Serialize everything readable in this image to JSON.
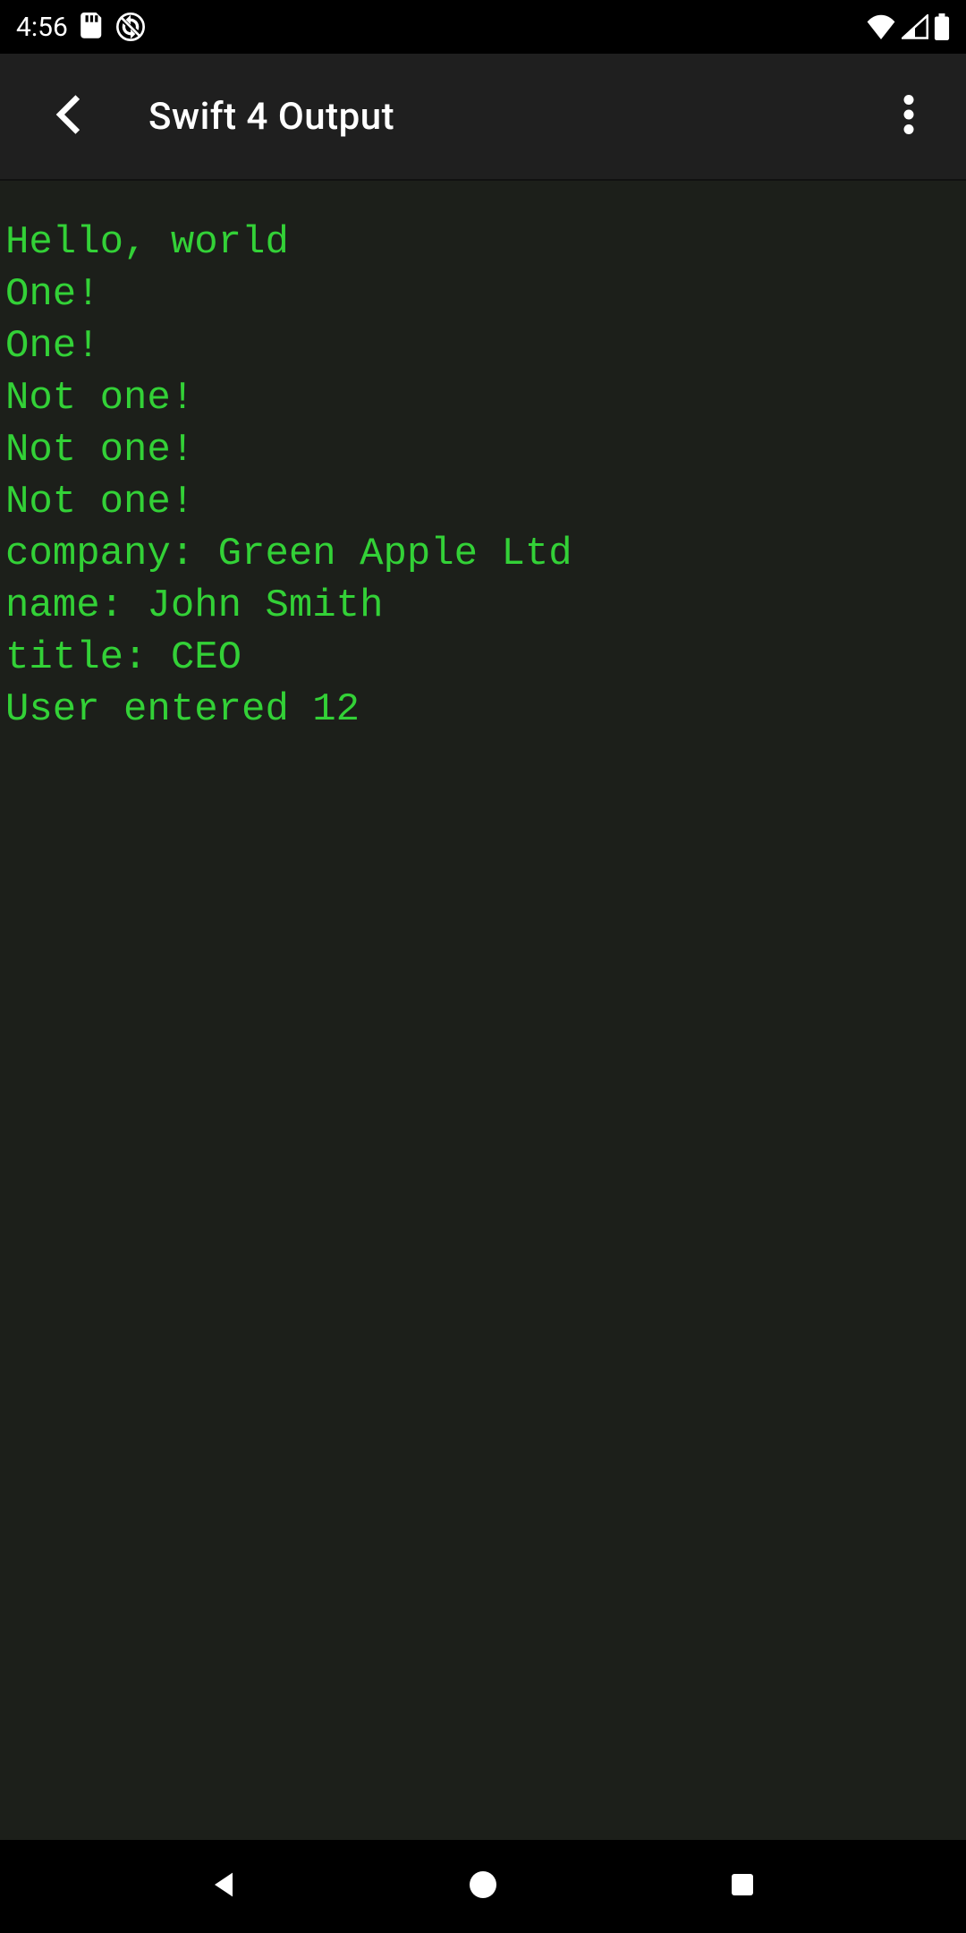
{
  "status": {
    "time": "4:56"
  },
  "header": {
    "title": "Swift 4 Output"
  },
  "output": {
    "lines": [
      "Hello, world",
      "One!",
      "One!",
      "Not one!",
      "Not one!",
      "Not one!",
      "company: Green Apple Ltd",
      "name: John Smith",
      "title: CEO",
      "User entered 12"
    ]
  },
  "colors": {
    "terminal_fg": "#33d137",
    "terminal_bg": "#1c1f1a",
    "appbar_bg": "#1f1f1f"
  }
}
